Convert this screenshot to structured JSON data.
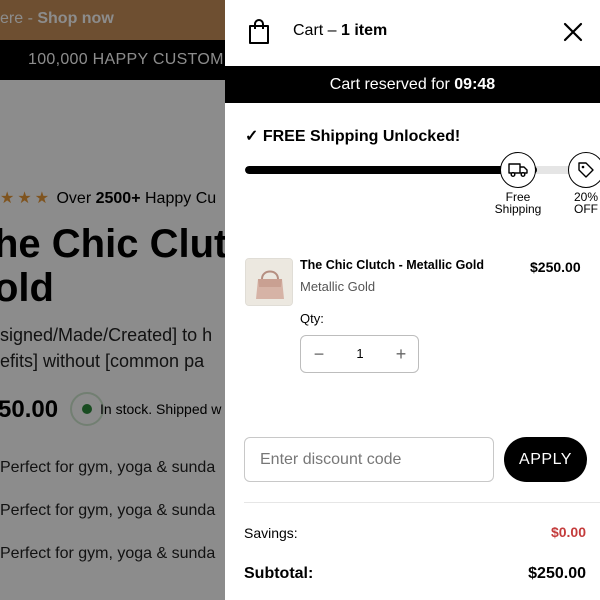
{
  "background_page": {
    "promo_text": "ere - ",
    "promo_link": "Shop now",
    "social_proof": "100,000 HAPPY CUSTOM",
    "rating_prefix": "Over ",
    "rating_count": "2500+",
    "rating_suffix": " Happy Cu",
    "title_line1": "he Chic Clut",
    "title_line2": "old",
    "desc_line1": "signed/Made/Created] to h",
    "desc_line2": "efits] without [common pa",
    "price": "50.00",
    "stock_text": "In stock. Shipped w",
    "bullets": [
      "Perfect for gym, yoga & sunda",
      "Perfect for gym, yoga & sunda",
      "Perfect for gym, yoga & sunda"
    ]
  },
  "cart": {
    "title_prefix": "Cart – ",
    "item_count": "1 item",
    "reserved_prefix": "Cart reserved for ",
    "reserved_timer": "09:48",
    "shipping_message": "✓ FREE Shipping Unlocked!",
    "progress_fraction": 0.86,
    "milestones": [
      {
        "label_line1": "Free",
        "label_line2": "Shipping",
        "icon": "truck-icon"
      },
      {
        "label_line1": "20%",
        "label_line2": "OFF",
        "icon": "tag-icon"
      }
    ],
    "item": {
      "name": "The Chic Clutch - Metallic Gold",
      "variant": "Metallic Gold",
      "price": "$250.00",
      "qty_label": "Qty:",
      "qty": "1",
      "minus": "−",
      "plus": "+"
    },
    "discount": {
      "placeholder": "Enter discount code",
      "apply_label": "APPLY"
    },
    "savings_label": "Savings:",
    "savings_value": "$0.00",
    "subtotal_label": "Subtotal:",
    "subtotal_value": "$250.00"
  },
  "colors": {
    "promo_bar": "#c9915a",
    "accent_black": "#000000",
    "savings_red": "#c43c3c",
    "in_stock_green": "#2e8b3c",
    "star_orange": "#e89a3a"
  }
}
